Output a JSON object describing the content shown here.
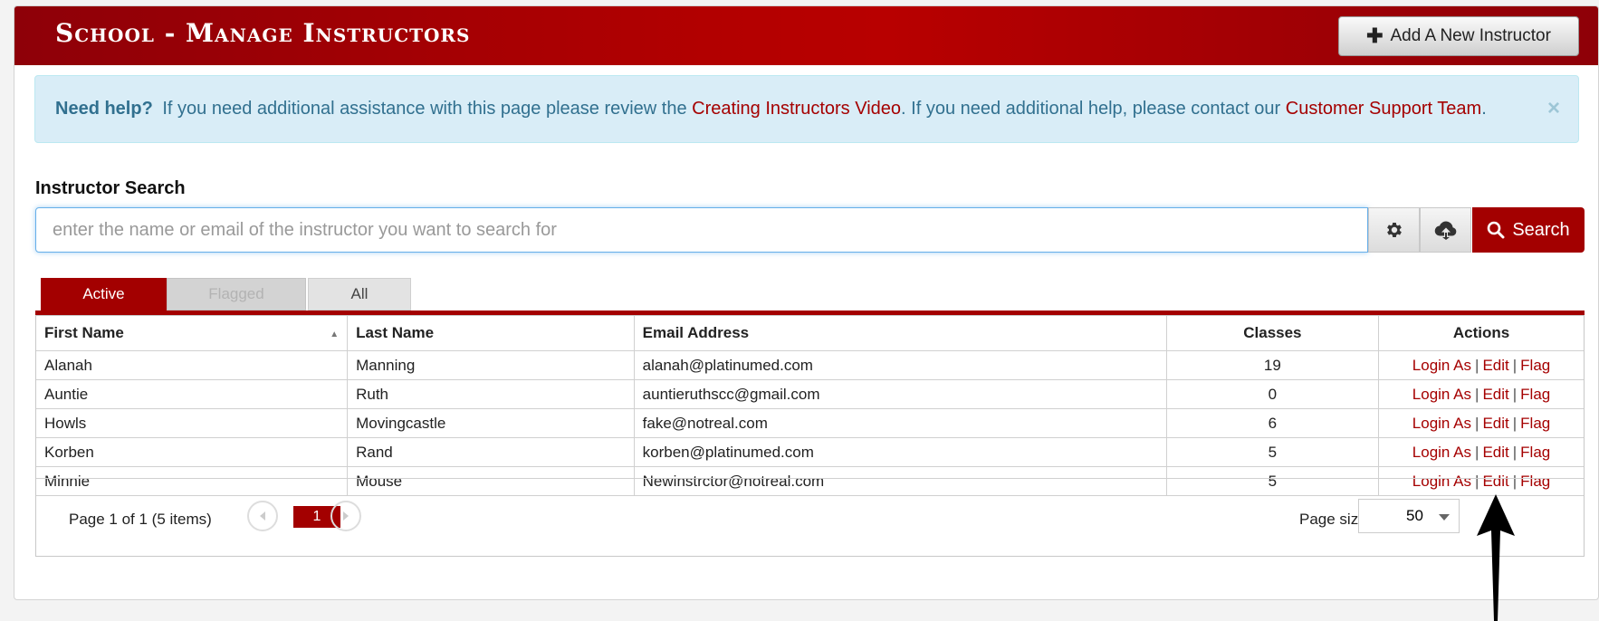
{
  "header": {
    "title": "School - Manage Instructors",
    "add_button_label": "Add A New Instructor",
    "add_button_icon": "plus-icon"
  },
  "help": {
    "lead": "Need help?",
    "text_1": "If you need additional assistance with this page please review the",
    "link_1": "Creating Instructors Video",
    "text_2": ". If you need additional help, please contact our",
    "link_2": "Customer Support Team",
    "text_3": ".",
    "close_symbol": "×"
  },
  "search": {
    "label": "Instructor Search",
    "placeholder": "enter the name or email of the instructor you want to search for",
    "value": "",
    "settings_icon": "gear-icon",
    "download_icon": "cloud-download-icon",
    "button_label": "Search",
    "button_icon": "search-icon"
  },
  "tabs": [
    {
      "label": "Active",
      "state": "active"
    },
    {
      "label": "Flagged",
      "state": "disabled"
    },
    {
      "label": "All",
      "state": "normal"
    }
  ],
  "table": {
    "columns": [
      "First Name",
      "Last Name",
      "Email Address",
      "Classes",
      "Actions"
    ],
    "sorted_column": "First Name",
    "sort_direction": "ascending",
    "actions": [
      "Login As",
      "Edit",
      "Flag"
    ],
    "action_separator": "|",
    "rows": [
      {
        "first": "Alanah",
        "last": "Manning",
        "email": "alanah@platinumed.com",
        "classes": "19"
      },
      {
        "first": "Auntie",
        "last": "Ruth",
        "email": "auntieruthscc@gmail.com",
        "classes": "0"
      },
      {
        "first": "Howls",
        "last": "Movingcastle",
        "email": "fake@notreal.com",
        "classes": "6"
      },
      {
        "first": "Korben",
        "last": "Rand",
        "email": "korben@platinumed.com",
        "classes": "5"
      },
      {
        "first": "Minnie",
        "last": "Mouse",
        "email": "Newinstrctor@notreal.com",
        "classes": "5"
      }
    ]
  },
  "pager": {
    "info": "Page 1 of 1 (5 items)",
    "current_page": "1",
    "page_size_label": "Page size:",
    "page_size_value": "50"
  },
  "colors": {
    "brand_red": "#a30000",
    "link_red": "#a50000",
    "help_bg": "#d9edf7",
    "help_text": "#31708f"
  }
}
